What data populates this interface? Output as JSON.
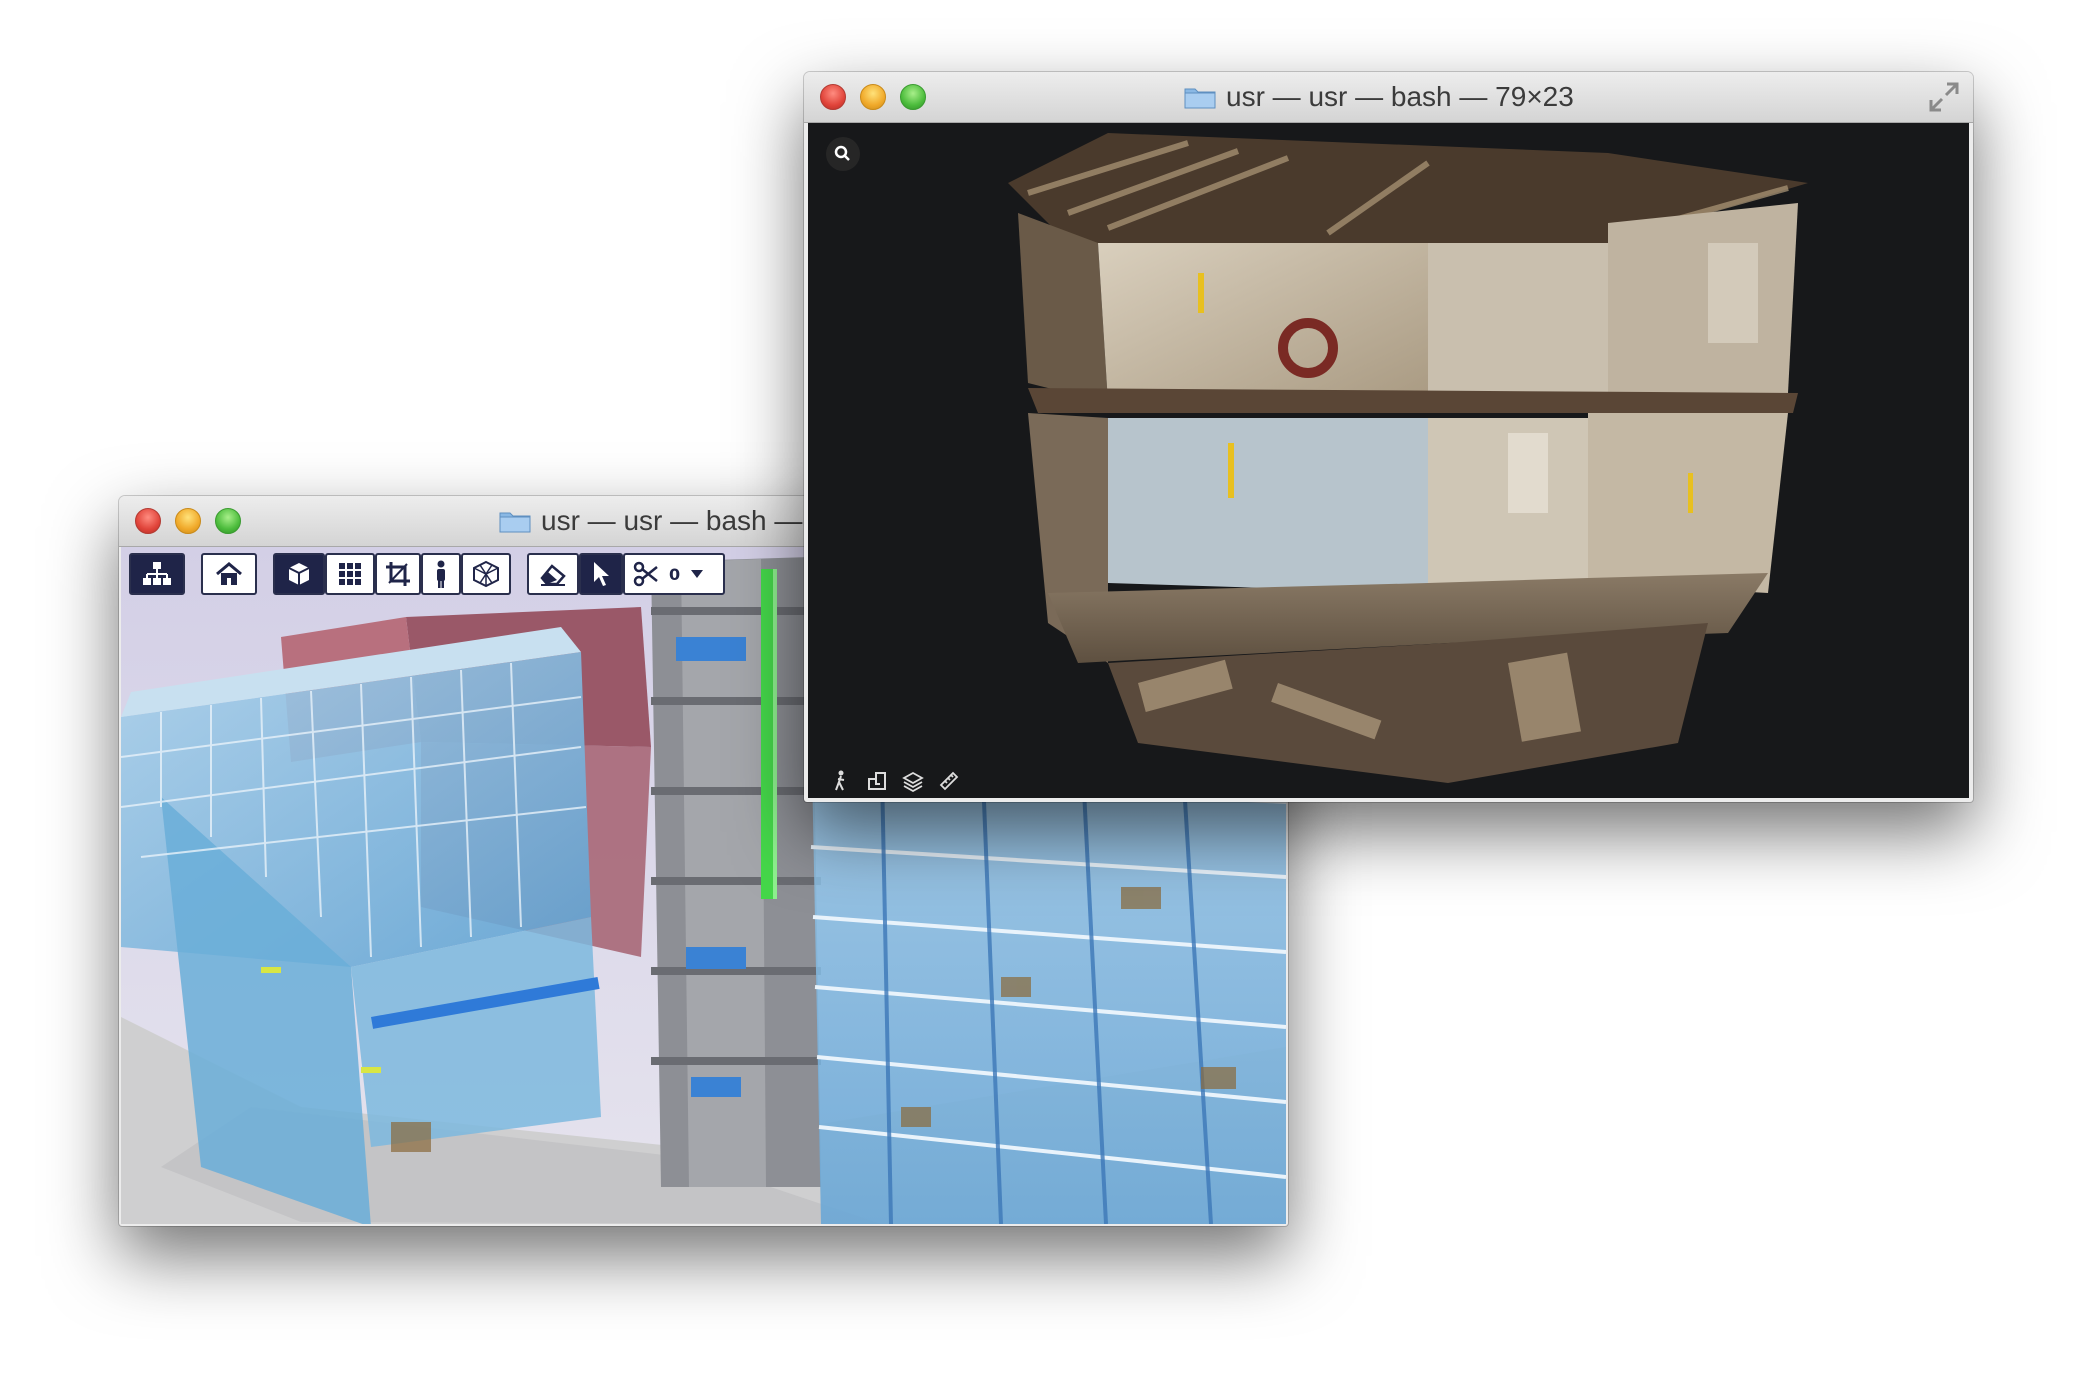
{
  "bim_window": {
    "title": "usr — usr — bash —",
    "toolbar": {
      "tree": "tree-structure-icon",
      "home": "home-icon",
      "cube": "cube-view-icon",
      "grid": "grid-icon",
      "crop": "crop-icon",
      "person": "person-icon",
      "section": "section-box-icon",
      "eraser": "eraser-icon",
      "pointer": "pointer-cursor-icon",
      "scissors": "scissors-icon",
      "cut_count": "0",
      "dropdown": "chevron-down-icon"
    }
  },
  "scan_window": {
    "title": "usr — usr — bash — 79×23",
    "controls": {
      "search": "search-icon",
      "walk": "walk-person-icon",
      "floorplan": "floorplan-icon",
      "layers": "layers-icon",
      "measure": "ruler-icon",
      "resize": "fullscreen-arrows-icon"
    }
  },
  "colors": {
    "toolbar_dark": "#1f2448",
    "glass": "#7fb6dc",
    "red_roof": "#b05a6a",
    "green_column": "#3fd13f",
    "scan_background": "#17181a"
  }
}
